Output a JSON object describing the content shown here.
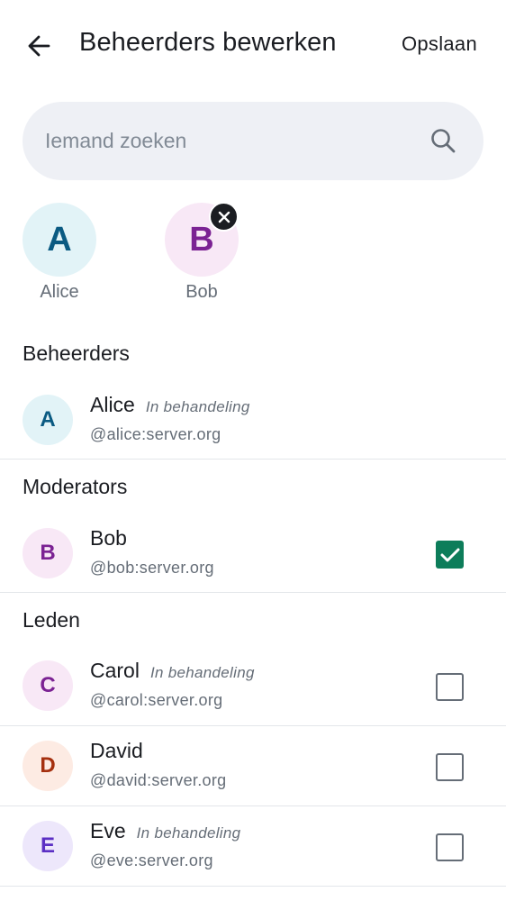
{
  "header": {
    "title": "Beheerders bewerken",
    "save_label": "Opslaan",
    "back_icon": "arrow-left-icon"
  },
  "search": {
    "placeholder": "Iemand zoeken",
    "value": "",
    "icon": "search-icon"
  },
  "selected": [
    {
      "initial": "A",
      "name": "Alice",
      "bg": "#e2f3f7",
      "fg": "#0a5a82",
      "removable": false
    },
    {
      "initial": "B",
      "name": "Bob",
      "bg": "#f8e8f6",
      "fg": "#7b2293",
      "removable": true
    }
  ],
  "sections": {
    "admins": "Beheerders",
    "moderators": "Moderators",
    "members": "Leden"
  },
  "users": [
    {
      "initial": "A",
      "name": "Alice",
      "pending": "In behandeling",
      "handle": "@alice:server.org",
      "bg": "#e2f3f7",
      "fg": "#0a5a82",
      "checkbox": "none"
    },
    {
      "initial": "B",
      "name": "Bob",
      "pending": "",
      "handle": "@bob:server.org",
      "bg": "#f8e8f6",
      "fg": "#7b2293",
      "checkbox": "checked"
    },
    {
      "initial": "C",
      "name": "Carol",
      "pending": "In behandeling",
      "handle": "@carol:server.org",
      "bg": "#f8e8f6",
      "fg": "#7b2293",
      "checkbox": "unchecked"
    },
    {
      "initial": "D",
      "name": "David",
      "pending": "",
      "handle": "@david:server.org",
      "bg": "#fdebe3",
      "fg": "#a5300f",
      "checkbox": "unchecked"
    },
    {
      "initial": "E",
      "name": "Eve",
      "pending": "In behandeling",
      "handle": "@eve:server.org",
      "bg": "#ede7fb",
      "fg": "#5b2fc4",
      "checkbox": "unchecked"
    }
  ],
  "colors": {
    "accent": "#0d7d5a",
    "text": "#1b1d22",
    "secondary_text": "#656d77",
    "search_bg": "#eef0f5"
  }
}
